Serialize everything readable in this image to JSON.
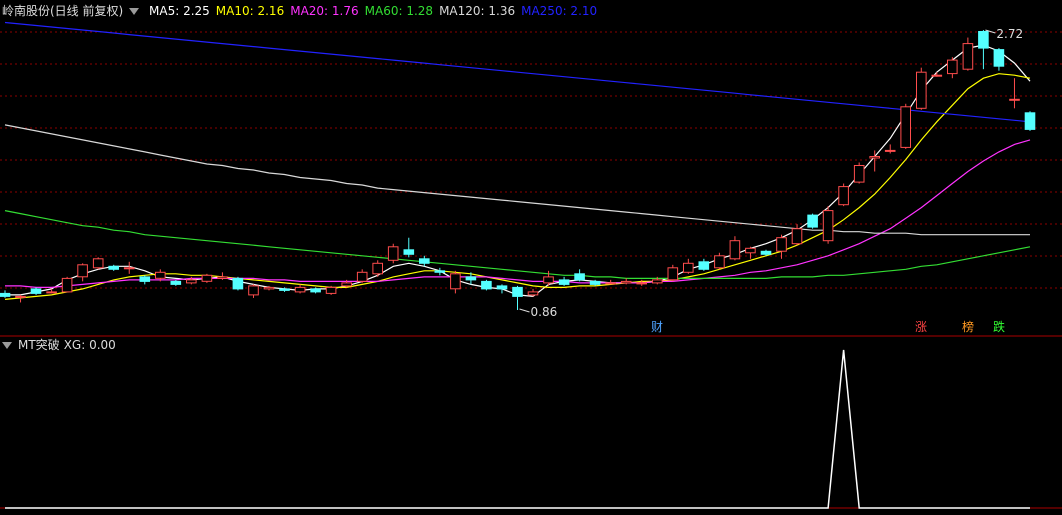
{
  "chart_data": [
    {
      "type": "candlestick",
      "title": "岭南股份(日线 前复权)",
      "indicators": [
        {
          "name": "MA5",
          "label": "MA5: 2.25",
          "color": "#ffffff"
        },
        {
          "name": "MA10",
          "label": "MA10: 2.16",
          "color": "#ffff00"
        },
        {
          "name": "MA20",
          "label": "MA20: 1.76",
          "color": "#ff33ff"
        },
        {
          "name": "MA60",
          "label": "MA60: 1.28",
          "color": "#33dd33"
        },
        {
          "name": "MA120",
          "label": "MA120: 1.36",
          "color": "#d8d8d8"
        },
        {
          "name": "MA250",
          "label": "MA250: 2.10",
          "color": "#2222ff"
        }
      ],
      "annotations": {
        "high_label": "2.72",
        "low_label": "0.86"
      },
      "event_markers": [
        {
          "label": "财",
          "color": "#4fa3ff",
          "index": 42
        },
        {
          "label": "涨",
          "color": "#ff4444",
          "index": 59
        },
        {
          "label": "榜",
          "color": "#ff9922",
          "index": 62
        },
        {
          "label": "跌",
          "color": "#33ff33",
          "index": 64
        }
      ],
      "ylim": [
        0.78,
        2.8
      ],
      "colors": {
        "up": "#ff4d4d",
        "down": "#54ffff"
      },
      "candles": [
        [
          0.97,
          0.95,
          0.99,
          0.94
        ],
        [
          0.95,
          0.95,
          0.96,
          0.91
        ],
        [
          1.0,
          0.97,
          1.01,
          0.96
        ],
        [
          0.98,
          0.98,
          1.0,
          0.97
        ],
        [
          0.98,
          1.07,
          1.08,
          0.98
        ],
        [
          1.08,
          1.16,
          1.17,
          1.05
        ],
        [
          1.14,
          1.2,
          1.21,
          1.13
        ],
        [
          1.15,
          1.13,
          1.16,
          1.12
        ],
        [
          1.14,
          1.14,
          1.18,
          1.1
        ],
        [
          1.08,
          1.05,
          1.09,
          1.03
        ],
        [
          1.07,
          1.11,
          1.13,
          1.05
        ],
        [
          1.05,
          1.03,
          1.06,
          1.02
        ],
        [
          1.04,
          1.06,
          1.08,
          1.03
        ],
        [
          1.05,
          1.09,
          1.1,
          1.04
        ],
        [
          1.07,
          1.08,
          1.11,
          1.06
        ],
        [
          1.07,
          1.0,
          1.08,
          0.99
        ],
        [
          0.96,
          1.02,
          1.03,
          0.94
        ],
        [
          1.0,
          1.01,
          1.02,
          0.99
        ],
        [
          1.0,
          0.99,
          1.01,
          0.98
        ],
        [
          0.98,
          1.01,
          1.03,
          0.97
        ],
        [
          1.0,
          0.98,
          1.01,
          0.97
        ],
        [
          0.97,
          1.01,
          1.02,
          0.96
        ],
        [
          1.02,
          1.04,
          1.06,
          1.01
        ],
        [
          1.05,
          1.11,
          1.13,
          1.04
        ],
        [
          1.1,
          1.17,
          1.19,
          1.08
        ],
        [
          1.19,
          1.28,
          1.3,
          1.17
        ],
        [
          1.26,
          1.23,
          1.34,
          1.21
        ],
        [
          1.2,
          1.17,
          1.22,
          1.15
        ],
        [
          1.12,
          1.11,
          1.14,
          1.09
        ],
        [
          1.0,
          1.1,
          1.12,
          0.97
        ],
        [
          1.08,
          1.06,
          1.11,
          1.03
        ],
        [
          1.05,
          1.0,
          1.06,
          0.99
        ],
        [
          1.02,
          1.0,
          1.03,
          0.97
        ],
        [
          1.01,
          0.95,
          1.02,
          0.86
        ],
        [
          0.96,
          0.98,
          1.0,
          0.95
        ],
        [
          1.04,
          1.08,
          1.12,
          1.02
        ],
        [
          1.06,
          1.03,
          1.08,
          1.02
        ],
        [
          1.1,
          1.06,
          1.13,
          1.05
        ],
        [
          1.05,
          1.03,
          1.06,
          1.02
        ],
        [
          1.04,
          1.04,
          1.06,
          1.03
        ],
        [
          1.04,
          1.05,
          1.07,
          1.03
        ],
        [
          1.04,
          1.04,
          1.06,
          1.02
        ],
        [
          1.04,
          1.06,
          1.08,
          1.03
        ],
        [
          1.06,
          1.14,
          1.16,
          1.05
        ],
        [
          1.11,
          1.17,
          1.2,
          1.1
        ],
        [
          1.18,
          1.13,
          1.2,
          1.12
        ],
        [
          1.14,
          1.22,
          1.24,
          1.13
        ],
        [
          1.2,
          1.32,
          1.35,
          1.19
        ],
        [
          1.24,
          1.27,
          1.28,
          1.2
        ],
        [
          1.25,
          1.23,
          1.26,
          1.22
        ],
        [
          1.25,
          1.34,
          1.36,
          1.2
        ],
        [
          1.3,
          1.4,
          1.43,
          1.29
        ],
        [
          1.49,
          1.41,
          1.5,
          1.4
        ],
        [
          1.32,
          1.52,
          1.55,
          1.3
        ],
        [
          1.56,
          1.68,
          1.7,
          1.55
        ],
        [
          1.71,
          1.82,
          1.84,
          1.7
        ],
        [
          1.87,
          1.88,
          1.92,
          1.78
        ],
        [
          1.92,
          1.92,
          1.96,
          1.9
        ],
        [
          1.94,
          2.21,
          2.23,
          1.93
        ],
        [
          2.2,
          2.44,
          2.47,
          2.19
        ],
        [
          2.42,
          2.42,
          2.44,
          2.41
        ],
        [
          2.43,
          2.52,
          2.54,
          2.4
        ],
        [
          2.46,
          2.63,
          2.67,
          2.45
        ],
        [
          2.71,
          2.6,
          2.72,
          2.46
        ],
        [
          2.59,
          2.48,
          2.6,
          2.45
        ],
        [
          2.26,
          2.26,
          2.4,
          2.2
        ],
        [
          2.17,
          2.06,
          2.18,
          2.05
        ]
      ],
      "ma_series": {
        "MA5": [
          0.96,
          0.96,
          0.98,
          1.0,
          1.06,
          1.1,
          1.13,
          1.15,
          1.15,
          1.12,
          1.08,
          1.07,
          1.06,
          1.07,
          1.08,
          1.05,
          1.03,
          1.01,
          1.0,
          0.99,
          1.0,
          1.0,
          1.02,
          1.05,
          1.09,
          1.15,
          1.17,
          1.15,
          1.12,
          1.06,
          1.03,
          1.01,
          1.0,
          0.96,
          0.95,
          1.03,
          1.05,
          1.06,
          1.05,
          1.04,
          1.04,
          1.04,
          1.05,
          1.08,
          1.13,
          1.16,
          1.2,
          1.23,
          1.27,
          1.3,
          1.34,
          1.39,
          1.46,
          1.54,
          1.64,
          1.76,
          1.88,
          2.0,
          2.16,
          2.32,
          2.44,
          2.52,
          2.6,
          2.62,
          2.58,
          2.5,
          2.38
        ],
        "MA10": [
          0.93,
          0.94,
          0.95,
          0.96,
          0.98,
          1.0,
          1.03,
          1.06,
          1.08,
          1.09,
          1.1,
          1.1,
          1.09,
          1.09,
          1.08,
          1.07,
          1.06,
          1.05,
          1.04,
          1.03,
          1.02,
          1.01,
          1.01,
          1.03,
          1.05,
          1.08,
          1.1,
          1.12,
          1.12,
          1.11,
          1.1,
          1.08,
          1.06,
          1.04,
          1.02,
          1.01,
          1.01,
          1.02,
          1.02,
          1.03,
          1.04,
          1.05,
          1.05,
          1.06,
          1.08,
          1.1,
          1.13,
          1.16,
          1.19,
          1.22,
          1.25,
          1.29,
          1.34,
          1.39,
          1.46,
          1.54,
          1.63,
          1.74,
          1.86,
          1.99,
          2.11,
          2.22,
          2.33,
          2.4,
          2.43,
          2.42,
          2.4
        ],
        "MA20": [
          1.02,
          1.02,
          1.01,
          1.01,
          1.02,
          1.03,
          1.04,
          1.05,
          1.06,
          1.06,
          1.06,
          1.06,
          1.07,
          1.07,
          1.07,
          1.07,
          1.07,
          1.06,
          1.06,
          1.05,
          1.05,
          1.05,
          1.05,
          1.05,
          1.05,
          1.06,
          1.07,
          1.08,
          1.08,
          1.08,
          1.08,
          1.08,
          1.07,
          1.06,
          1.05,
          1.05,
          1.05,
          1.04,
          1.04,
          1.04,
          1.04,
          1.04,
          1.05,
          1.05,
          1.06,
          1.07,
          1.08,
          1.09,
          1.11,
          1.12,
          1.14,
          1.16,
          1.19,
          1.22,
          1.26,
          1.3,
          1.35,
          1.4,
          1.47,
          1.54,
          1.62,
          1.7,
          1.78,
          1.85,
          1.91,
          1.96,
          1.99
        ],
        "MA60": [
          1.52,
          1.5,
          1.48,
          1.46,
          1.44,
          1.42,
          1.41,
          1.39,
          1.38,
          1.36,
          1.35,
          1.34,
          1.33,
          1.32,
          1.31,
          1.3,
          1.29,
          1.28,
          1.27,
          1.26,
          1.25,
          1.24,
          1.23,
          1.22,
          1.21,
          1.2,
          1.19,
          1.18,
          1.17,
          1.16,
          1.15,
          1.14,
          1.13,
          1.12,
          1.11,
          1.1,
          1.09,
          1.09,
          1.08,
          1.08,
          1.07,
          1.07,
          1.07,
          1.07,
          1.07,
          1.07,
          1.07,
          1.07,
          1.07,
          1.07,
          1.08,
          1.08,
          1.08,
          1.09,
          1.09,
          1.1,
          1.11,
          1.12,
          1.13,
          1.15,
          1.16,
          1.18,
          1.2,
          1.22,
          1.24,
          1.26,
          1.28
        ],
        "MA120": [
          2.09,
          2.07,
          2.05,
          2.03,
          2.01,
          1.99,
          1.97,
          1.95,
          1.93,
          1.91,
          1.89,
          1.87,
          1.85,
          1.83,
          1.82,
          1.8,
          1.79,
          1.77,
          1.76,
          1.74,
          1.73,
          1.72,
          1.7,
          1.69,
          1.67,
          1.66,
          1.65,
          1.64,
          1.63,
          1.62,
          1.61,
          1.6,
          1.59,
          1.58,
          1.57,
          1.56,
          1.55,
          1.54,
          1.53,
          1.52,
          1.51,
          1.5,
          1.49,
          1.48,
          1.47,
          1.46,
          1.45,
          1.44,
          1.43,
          1.42,
          1.41,
          1.4,
          1.39,
          1.39,
          1.38,
          1.38,
          1.37,
          1.37,
          1.37,
          1.36,
          1.36,
          1.36,
          1.36,
          1.36,
          1.36,
          1.36,
          1.36
        ],
        "MA250": [
          2.77,
          2.76,
          2.75,
          2.74,
          2.73,
          2.72,
          2.71,
          2.7,
          2.69,
          2.68,
          2.67,
          2.66,
          2.65,
          2.64,
          2.63,
          2.62,
          2.61,
          2.6,
          2.59,
          2.58,
          2.57,
          2.56,
          2.55,
          2.54,
          2.53,
          2.52,
          2.51,
          2.5,
          2.49,
          2.48,
          2.47,
          2.46,
          2.45,
          2.44,
          2.43,
          2.42,
          2.41,
          2.4,
          2.39,
          2.38,
          2.37,
          2.36,
          2.35,
          2.34,
          2.33,
          2.32,
          2.31,
          2.3,
          2.29,
          2.28,
          2.27,
          2.26,
          2.25,
          2.24,
          2.23,
          2.22,
          2.21,
          2.2,
          2.19,
          2.18,
          2.17,
          2.16,
          2.15,
          2.14,
          2.13,
          2.12,
          2.11
        ]
      }
    },
    {
      "type": "line",
      "title": "MT突破",
      "indicator_label": "XG: 0.00",
      "color": "#ffffff",
      "ylim": [
        0,
        1
      ],
      "values": [
        0,
        0,
        0,
        0,
        0,
        0,
        0,
        0,
        0,
        0,
        0,
        0,
        0,
        0,
        0,
        0,
        0,
        0,
        0,
        0,
        0,
        0,
        0,
        0,
        0,
        0,
        0,
        0,
        0,
        0,
        0,
        0,
        0,
        0,
        0,
        0,
        0,
        0,
        0,
        0,
        0,
        0,
        0,
        0,
        0,
        0,
        0,
        0,
        0,
        0,
        0,
        0,
        0,
        0,
        1,
        0,
        0,
        0,
        0,
        0,
        0,
        0,
        0,
        0,
        0,
        0,
        0
      ]
    }
  ]
}
